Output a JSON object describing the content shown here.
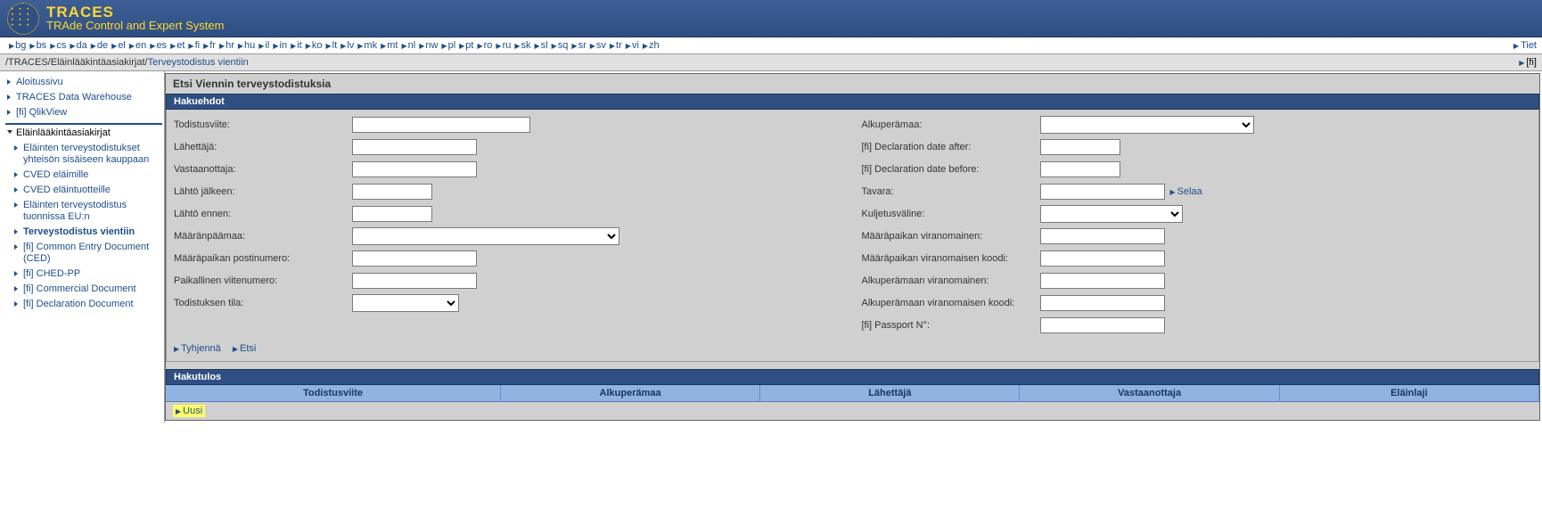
{
  "header": {
    "title": "TRACES",
    "subtitle": "TRAde Control and Expert System"
  },
  "languages": [
    "bg",
    "bs",
    "cs",
    "da",
    "de",
    "el",
    "en",
    "es",
    "et",
    "fi",
    "fr",
    "hr",
    "hu",
    "il",
    "in",
    "it",
    "ko",
    "lt",
    "lv",
    "mk",
    "mt",
    "nl",
    "nw",
    "pl",
    "pt",
    "ro",
    "ru",
    "sk",
    "sl",
    "sq",
    "sr",
    "sv",
    "tr",
    "vi",
    "zh"
  ],
  "lang_right": "Tiet",
  "breadcrumb": {
    "root": "/TRACES/",
    "mid": "Eläinlääkintäasiakirjat/",
    "leaf": "Terveystodistus vientiin",
    "right": "[fi]"
  },
  "sidebar": {
    "top": [
      {
        "label": "Aloitussivu"
      },
      {
        "label": "TRACES Data Warehouse"
      },
      {
        "label": "[fi] QlikView"
      }
    ],
    "section": "Eläinlääkintäasiakirjat",
    "items": [
      {
        "label": "Eläinten terveystodistukset yhteisön sisäiseen kauppaan"
      },
      {
        "label": "CVED eläimille"
      },
      {
        "label": "CVED eläintuotteille"
      },
      {
        "label": "Eläinten terveystodistus tuonnissa EU:n"
      },
      {
        "label": "Terveystodistus vientiin",
        "active": true
      },
      {
        "label": "[fi] Common Entry Document (CED)"
      },
      {
        "label": "[fi] CHED-PP"
      },
      {
        "label": "[fi] Commercial Document"
      },
      {
        "label": "[fi] Declaration Document"
      }
    ]
  },
  "page": {
    "title": "Etsi Viennin terveystodistuksia",
    "criteria_header": "Hakuehdot",
    "left_fields": [
      {
        "label": "Todistusviite:",
        "type": "text",
        "w": "w-lg"
      },
      {
        "label": "Lähettäjä:",
        "type": "text",
        "w": "w-md"
      },
      {
        "label": "Vastaanottaja:",
        "type": "text",
        "w": "w-md"
      },
      {
        "label": "Lähtö jälkeen:",
        "type": "text",
        "w": "w-sm"
      },
      {
        "label": "Lähtö ennen:",
        "type": "text",
        "w": "w-sm"
      },
      {
        "label": "Määränpäämaa:",
        "type": "select",
        "w": "w-sel"
      },
      {
        "label": "Määräpaikan postinumero:",
        "type": "text",
        "w": "w-md"
      },
      {
        "label": "Paikallinen viitenumero:",
        "type": "text",
        "w": "w-md"
      },
      {
        "label": "Todistuksen tila:",
        "type": "select",
        "w": "w-sel-sm"
      }
    ],
    "right_fields": [
      {
        "label": "Alkuperämaa:",
        "type": "select",
        "w": "w-sel-lg"
      },
      {
        "label": "[fi] Declaration date after:",
        "type": "text",
        "w": "w-sm"
      },
      {
        "label": "[fi] Declaration date before:",
        "type": "text",
        "w": "w-sm"
      },
      {
        "label": "Tavara:",
        "type": "text",
        "w": "w-md",
        "browse": "Selaa"
      },
      {
        "label": "Kuljetusväline:",
        "type": "select",
        "w": "w-sel-md"
      },
      {
        "label": "Määräpaikan viranomainen:",
        "type": "text",
        "w": "w-md"
      },
      {
        "label": "Määräpaikan viranomaisen koodi:",
        "type": "text",
        "w": "w-md"
      },
      {
        "label": "Alkuperämaan viranomainen:",
        "type": "text",
        "w": "w-md"
      },
      {
        "label": "Alkuperämaan viranomaisen koodi:",
        "type": "text",
        "w": "w-md"
      },
      {
        "label": "[fi] Passport N°:",
        "type": "text",
        "w": "w-md"
      }
    ],
    "actions": {
      "clear": "Tyhjennä",
      "search": "Etsi"
    },
    "results_header": "Hakutulos",
    "columns": [
      "Todistusviite",
      "Alkuperämaa",
      "Lähettäjä",
      "Vastaanottaja",
      "Eläinlaji"
    ],
    "new_label": "Uusi"
  }
}
